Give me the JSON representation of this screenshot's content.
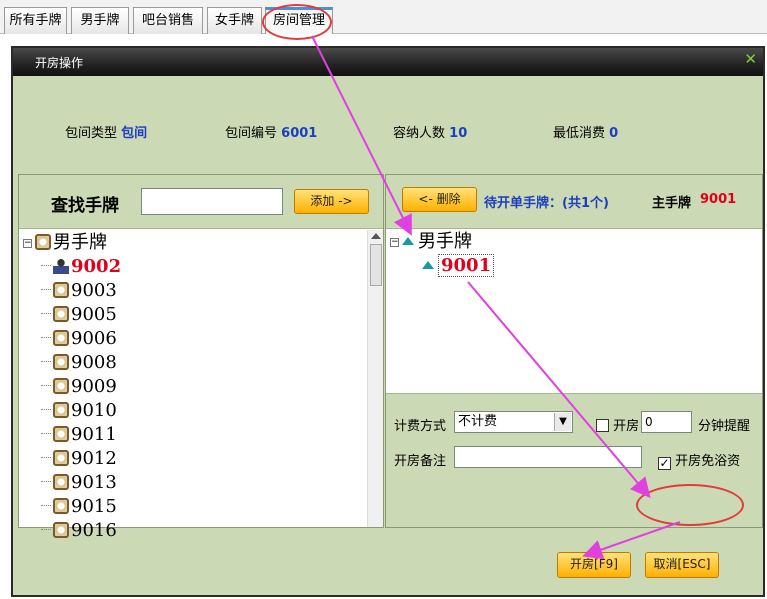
{
  "tabs": [
    {
      "label": "所有手牌"
    },
    {
      "label": "男手牌"
    },
    {
      "label": "吧台销售"
    },
    {
      "label": "女手牌"
    },
    {
      "label": "房间管理"
    }
  ],
  "dialog": {
    "title": "开房操作",
    "close": "✕",
    "info": {
      "room_type_label": "包间类型",
      "room_type_value": "包间",
      "room_no_label": "包间编号",
      "room_no_value": "6001",
      "capacity_label": "容纳人数",
      "capacity_value": "10",
      "min_spend_label": "最低消费",
      "min_spend_value": "0"
    },
    "left": {
      "search_label": "查找手牌",
      "search_value": "",
      "add_button": "添加 ->",
      "root": "男手牌",
      "items": [
        {
          "label": "9002",
          "highlight": true
        },
        {
          "label": "9003"
        },
        {
          "label": "9005"
        },
        {
          "label": "9006"
        },
        {
          "label": "9008"
        },
        {
          "label": "9009"
        },
        {
          "label": "9010"
        },
        {
          "label": "9011"
        },
        {
          "label": "9012"
        },
        {
          "label": "9013"
        },
        {
          "label": "9015"
        },
        {
          "label": "9016"
        }
      ]
    },
    "right": {
      "delete_button": "<- 删除",
      "pending_label": "待开单手牌：(共1个)",
      "main_label": "主手牌",
      "main_value": "9001",
      "root": "男手牌",
      "item": "9001",
      "billing_label": "计费方式",
      "billing_value": "不计费",
      "room_check_label": "开房",
      "minutes_value": "0",
      "minutes_label": "分钟提醒",
      "note_label": "开房备注",
      "note_value": "",
      "free_bath_label": "开房免浴资",
      "free_bath_checked": true
    },
    "open_button": "开房[F9]",
    "cancel_button": "取消[ESC]"
  },
  "colors": {
    "accent": "#ffb000",
    "panel": "#ccd9b5",
    "highlight_red": "#e0001a",
    "annotation": "#e23b3b",
    "arrow": "#e040e0"
  }
}
